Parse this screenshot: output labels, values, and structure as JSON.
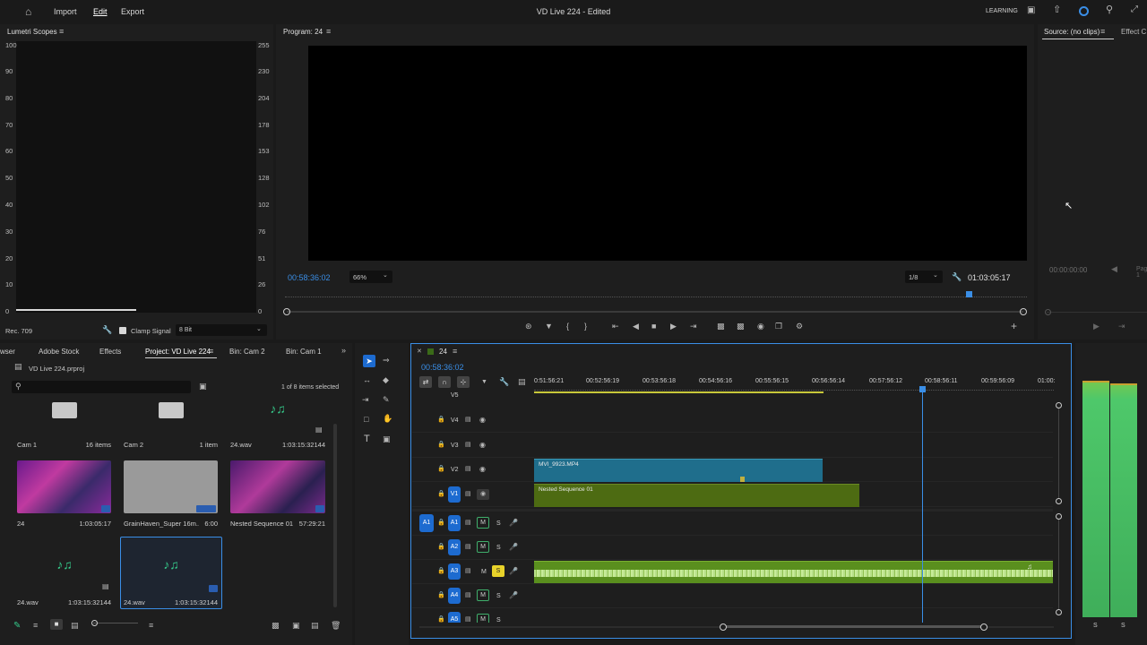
{
  "menu": {
    "items": [
      "Import",
      "Edit",
      "Export"
    ],
    "title": "VD Live 224 - Edited",
    "learning": "LEARNING"
  },
  "lumetri": {
    "title": "Lumetri Scopes",
    "left_scale": [
      "100",
      "90",
      "80",
      "70",
      "60",
      "50",
      "40",
      "30",
      "20",
      "10",
      "0"
    ],
    "right_scale": [
      "255",
      "230",
      "204",
      "178",
      "153",
      "128",
      "102",
      "76",
      "51",
      "26",
      "0"
    ],
    "rec": "Rec. 709",
    "clamp_label": "Clamp Signal",
    "bit_value": "8 Bit"
  },
  "program": {
    "title": "Program: 24",
    "timecode": "00:58:36:02",
    "zoom": "66%",
    "fraction": "1/8",
    "duration": "01:03:05:17"
  },
  "source": {
    "tab": "Source: (no clips)",
    "tab2": "Effect C",
    "timecode": "00:00:00:00",
    "page": "Page 1"
  },
  "project": {
    "tabs": [
      "wser",
      "Adobe Stock",
      "Effects",
      "Project: VD Live 224",
      "Bin: Cam 2",
      "Bin: Cam 1"
    ],
    "file": "VD Live 224.prproj",
    "selection": "1 of 8 items selected",
    "items": [
      {
        "name": "Cam 1",
        "meta": "16 items"
      },
      {
        "name": "Cam 2",
        "meta": "1 item"
      },
      {
        "name": "24.wav",
        "meta": "1:03:15:32144"
      },
      {
        "name": "24",
        "meta": "1:03:05:17"
      },
      {
        "name": "GrainHaven_Super 16m...",
        "meta": "6:00"
      },
      {
        "name": "Nested Sequence 01",
        "meta": "57:29:21"
      },
      {
        "name": "24.wav",
        "meta": "1:03:15:32144"
      },
      {
        "name": "24.wav",
        "meta": "1:03:15:32144"
      }
    ]
  },
  "timeline": {
    "tab": "24",
    "timecode": "00:58:36:02",
    "ruler": [
      "0:51:56:21",
      "00:52:56:19",
      "00:53:56:18",
      "00:54:56:16",
      "00:55:56:15",
      "00:56:56:14",
      "00:57:56:12",
      "00:58:56:11",
      "00:59:56:09",
      "01:00:"
    ],
    "video_tracks": [
      "V5",
      "V4",
      "V3",
      "V2",
      "V1"
    ],
    "audio_tracks": [
      "A1",
      "A2",
      "A3",
      "A4",
      "A5"
    ],
    "clip_v2": "MVI_9923.MP4",
    "clip_v1": "Nested Sequence 01",
    "src_a1": "A1",
    "m": "M",
    "s": "S"
  },
  "meter": {
    "labels": [
      "S",
      "S"
    ]
  },
  "colors": {
    "accent": "#3a8ee6",
    "video_clip": "#1f6e8c",
    "nested_clip": "#4d6b12",
    "audio_clip": "#5a8f1e"
  }
}
